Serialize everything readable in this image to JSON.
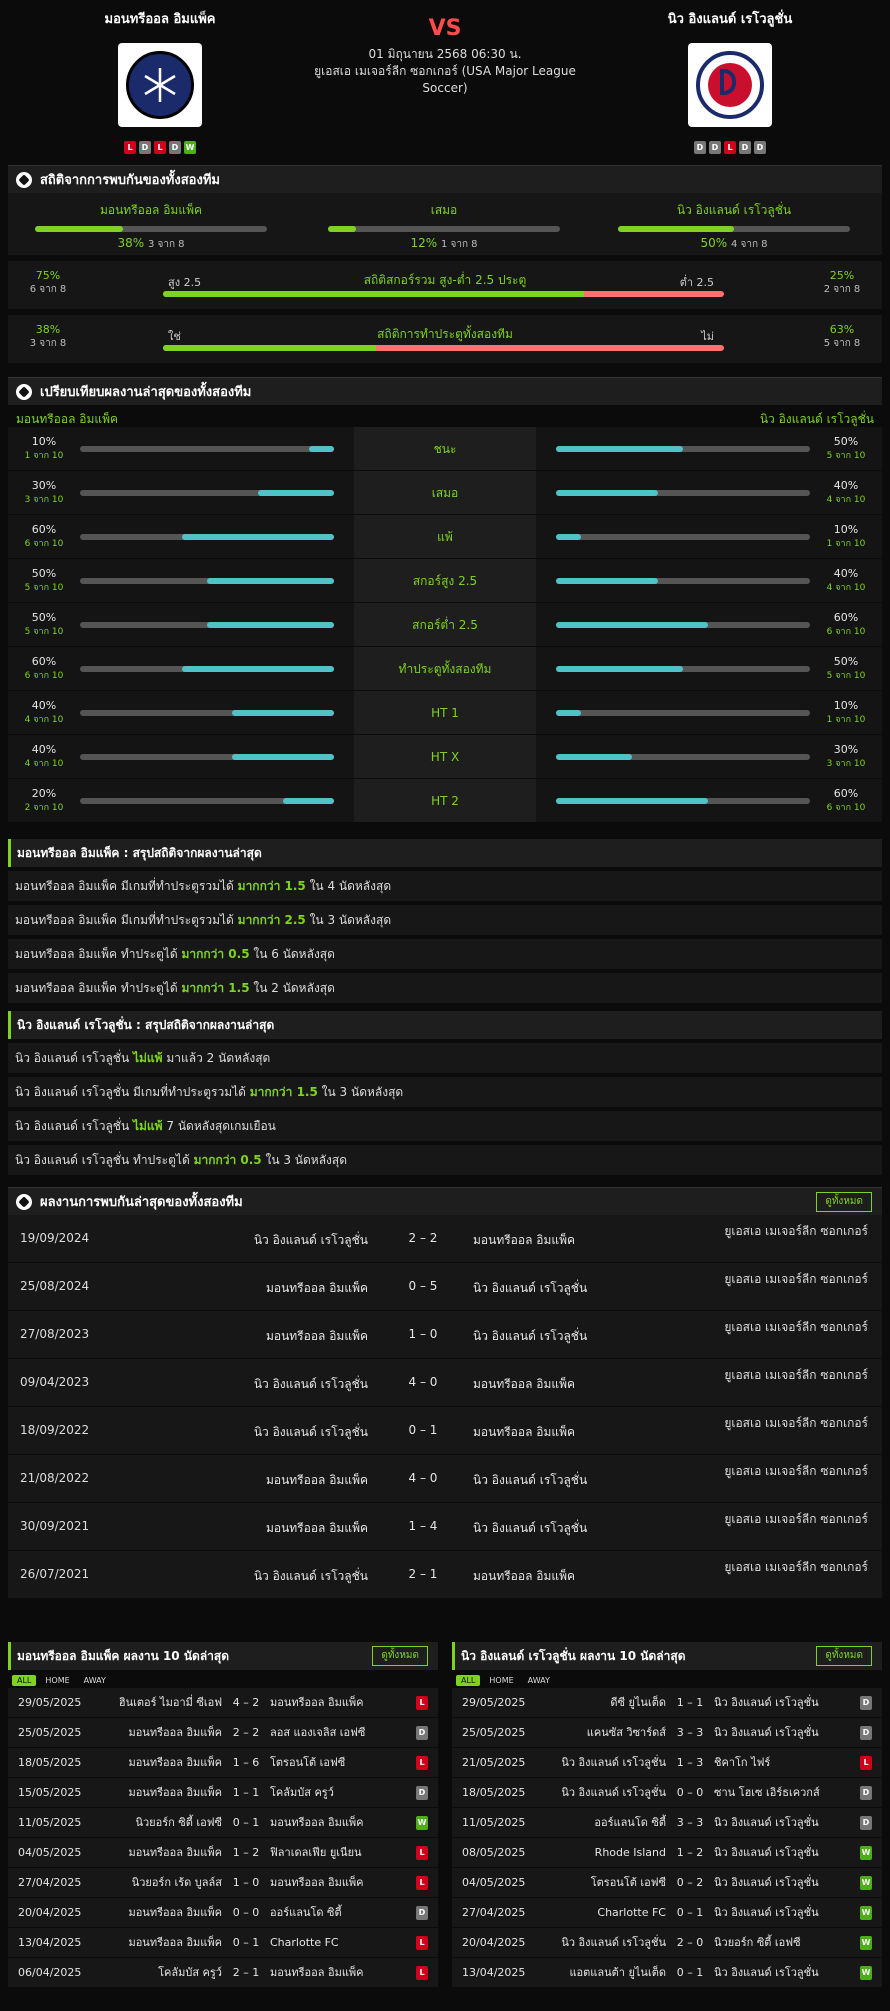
{
  "header": {
    "home_name": "มอนทรีออล อิมแพ็ค",
    "away_name": "นิว อิงแลนด์ เรโวลูชั่น",
    "vs": "VS",
    "datetime": "01 มิถุนายน 2568 06:30 น.",
    "league": "ยูเอสเอ เมเจอร์ลีก ซอกเกอร์ (USA Major League Soccer)",
    "home_form": [
      "L",
      "D",
      "L",
      "D",
      "W"
    ],
    "away_form": [
      "D",
      "D",
      "L",
      "D",
      "D"
    ],
    "home_logo_color": "#1b2a6b",
    "away_logo_color": "#c8102e"
  },
  "h2h_stats": {
    "title": "สถิติจากการพบกันของทั้งสองทีม",
    "cols": [
      {
        "label": "มอนทรีออล อิมแพ็ค",
        "pct": "38%",
        "count": "3 จาก 8",
        "value": 0.38
      },
      {
        "label": "เสมอ",
        "pct": "12%",
        "count": "1 จาก 8",
        "value": 0.12
      },
      {
        "label": "นิว อิงแลนด์ เรโวลูชั่น",
        "pct": "50%",
        "count": "4 จาก 8",
        "value": 0.5
      }
    ],
    "ou": {
      "left_pct": "75%",
      "left_count": "6 จาก 8",
      "left_label": "สูง 2.5",
      "title": "สถิติสกอร์รวม สูง-ต่ำ 2.5 ประตู",
      "right_label": "ต่ำ 2.5",
      "right_pct": "25%",
      "right_count": "2 จาก 8",
      "value": 0.75
    },
    "btts": {
      "left_pct": "38%",
      "left_count": "3 จาก 8",
      "left_label": "ใช่",
      "title": "สถิติการทำประตูทั้งสองทีม",
      "right_label": "ไม่",
      "right_pct": "63%",
      "right_count": "5 จาก 8",
      "value": 0.38
    }
  },
  "compare": {
    "title": "เปรียบเทียบผลงานล่าสุดของทั้งสองทีม",
    "home_name": "มอนทรีออล อิมแพ็ค",
    "away_name": "นิว อิงแลนด์ เรโวลูชั่น",
    "rows": [
      {
        "label": "ชนะ",
        "hp": "10%",
        "hc": "1 จาก 10",
        "hv": 0.1,
        "ap": "50%",
        "ac": "5 จาก 10",
        "av": 0.5
      },
      {
        "label": "เสมอ",
        "hp": "30%",
        "hc": "3 จาก 10",
        "hv": 0.3,
        "ap": "40%",
        "ac": "4 จาก 10",
        "av": 0.4
      },
      {
        "label": "แพ้",
        "hp": "60%",
        "hc": "6 จาก 10",
        "hv": 0.6,
        "ap": "10%",
        "ac": "1 จาก 10",
        "av": 0.1
      },
      {
        "label": "สกอร์สูง 2.5",
        "hp": "50%",
        "hc": "5 จาก 10",
        "hv": 0.5,
        "ap": "40%",
        "ac": "4 จาก 10",
        "av": 0.4
      },
      {
        "label": "สกอร์ต่ำ 2.5",
        "hp": "50%",
        "hc": "5 จาก 10",
        "hv": 0.5,
        "ap": "60%",
        "ac": "6 จาก 10",
        "av": 0.6
      },
      {
        "label": "ทำประตูทั้งสองทีม",
        "hp": "60%",
        "hc": "6 จาก 10",
        "hv": 0.6,
        "ap": "50%",
        "ac": "5 จาก 10",
        "av": 0.5
      },
      {
        "label": "HT 1",
        "hp": "40%",
        "hc": "4 จาก 10",
        "hv": 0.4,
        "ap": "10%",
        "ac": "1 จาก 10",
        "av": 0.1
      },
      {
        "label": "HT X",
        "hp": "40%",
        "hc": "4 จาก 10",
        "hv": 0.4,
        "ap": "30%",
        "ac": "3 จาก 10",
        "av": 0.3
      },
      {
        "label": "HT 2",
        "hp": "20%",
        "hc": "2 จาก 10",
        "hv": 0.2,
        "ap": "60%",
        "ac": "6 จาก 10",
        "av": 0.6
      }
    ]
  },
  "home_streaks": {
    "title": "มอนทรีออล อิมแพ็ค : สรุปสถิติจากผลงานล่าสุด",
    "rows": [
      [
        "มอนทรีออล อิมแพ็ค มีเกมที่ทำประตูรวมได้ ",
        "มากกว่า 1.5",
        " ใน 4 นัดหลังสุด"
      ],
      [
        "มอนทรีออล อิมแพ็ค มีเกมที่ทำประตูรวมได้ ",
        "มากกว่า 2.5",
        " ใน 3 นัดหลังสุด"
      ],
      [
        "มอนทรีออล อิมแพ็ค ทำประตูได้ ",
        "มากกว่า 0.5",
        " ใน 6 นัดหลังสุด"
      ],
      [
        "มอนทรีออล อิมแพ็ค ทำประตูได้ ",
        "มากกว่า 1.5",
        " ใน 2 นัดหลังสุด"
      ]
    ]
  },
  "away_streaks": {
    "title": "นิว อิงแลนด์ เรโวลูชั่น : สรุปสถิติจากผลงานล่าสุด",
    "rows": [
      [
        "นิว อิงแลนด์ เรโวลูชั่น ",
        "ไม่แพ้",
        " มาแล้ว 2 นัดหลังสุด"
      ],
      [
        "นิว อิงแลนด์ เรโวลูชั่น มีเกมที่ทำประตูรวมได้ ",
        "มากกว่า 1.5",
        " ใน 3 นัดหลังสุด"
      ],
      [
        "นิว อิงแลนด์ เรโวลูชั่น ",
        "ไม่แพ้",
        " 7 นัดหลังสุดเกมเยือน"
      ],
      [
        "นิว อิงแลนด์ เรโวลูชั่น ทำประตูได้ ",
        "มากกว่า 0.5",
        " ใน 3 นัดหลังสุด"
      ]
    ]
  },
  "h2h_results": {
    "title": "ผลงานการพบกันล่าสุดของทั้งสองทีม",
    "view_all": "ดูทั้งหมด",
    "rows": [
      {
        "date": "19/09/2024",
        "home": "นิว อิงแลนด์ เรโวลูชั่น",
        "score": "2 – 2",
        "away": "มอนทรีออล อิมแพ็ค",
        "league": "ยูเอสเอ เมเจอร์ลีก ซอกเกอร์"
      },
      {
        "date": "25/08/2024",
        "home": "มอนทรีออล อิมแพ็ค",
        "score": "0 – 5",
        "away": "นิว อิงแลนด์ เรโวลูชั่น",
        "league": "ยูเอสเอ เมเจอร์ลีก ซอกเกอร์"
      },
      {
        "date": "27/08/2023",
        "home": "มอนทรีออล อิมแพ็ค",
        "score": "1 – 0",
        "away": "นิว อิงแลนด์ เรโวลูชั่น",
        "league": "ยูเอสเอ เมเจอร์ลีก ซอกเกอร์"
      },
      {
        "date": "09/04/2023",
        "home": "นิว อิงแลนด์ เรโวลูชั่น",
        "score": "4 – 0",
        "away": "มอนทรีออล อิมแพ็ค",
        "league": "ยูเอสเอ เมเจอร์ลีก ซอกเกอร์"
      },
      {
        "date": "18/09/2022",
        "home": "นิว อิงแลนด์ เรโวลูชั่น",
        "score": "0 – 1",
        "away": "มอนทรีออล อิมแพ็ค",
        "league": "ยูเอสเอ เมเจอร์ลีก ซอกเกอร์"
      },
      {
        "date": "21/08/2022",
        "home": "มอนทรีออล อิมแพ็ค",
        "score": "4 – 0",
        "away": "นิว อิงแลนด์ เรโวลูชั่น",
        "league": "ยูเอสเอ เมเจอร์ลีก ซอกเกอร์"
      },
      {
        "date": "30/09/2021",
        "home": "มอนทรีออล อิมแพ็ค",
        "score": "1 – 4",
        "away": "นิว อิงแลนด์ เรโวลูชั่น",
        "league": "ยูเอสเอ เมเจอร์ลีก ซอกเกอร์"
      },
      {
        "date": "26/07/2021",
        "home": "นิว อิงแลนด์ เรโวลูชั่น",
        "score": "2 – 1",
        "away": "มอนทรีออล อิมแพ็ค",
        "league": "ยูเอสเอ เมเจอร์ลีก ซอกเกอร์"
      }
    ]
  },
  "home_last10": {
    "title": "มอนทรีออล อิมแพ็ค ผลงาน 10 นัดล่าสุด",
    "view_all": "ดูทั้งหมด",
    "filters": [
      "ALL",
      "HOME",
      "AWAY"
    ],
    "rows": [
      {
        "date": "29/05/2025",
        "home": "ฮินเตอร์ ไมอามี่ ซีเอฟ",
        "score": "4 – 2",
        "away": "มอนทรีออล อิมแพ็ค",
        "res": "L"
      },
      {
        "date": "25/05/2025",
        "home": "มอนทรีออล อิมแพ็ค",
        "score": "2 – 2",
        "away": "ลอส แองเจลิส เอฟซี",
        "res": "D"
      },
      {
        "date": "18/05/2025",
        "home": "มอนทรีออล อิมแพ็ค",
        "score": "1 – 6",
        "away": "โตรอนโต้ เอฟซี",
        "res": "L"
      },
      {
        "date": "15/05/2025",
        "home": "มอนทรีออล อิมแพ็ค",
        "score": "1 – 1",
        "away": "โคลัมบัส ครูว์",
        "res": "D"
      },
      {
        "date": "11/05/2025",
        "home": "นิวยอร์ก ซิตี้ เอฟซี",
        "score": "0 – 1",
        "away": "มอนทรีออล อิมแพ็ค",
        "res": "W"
      },
      {
        "date": "04/05/2025",
        "home": "มอนทรีออล อิมแพ็ค",
        "score": "1 – 2",
        "away": "ฟิลาเดลเฟีย ยูเนียน",
        "res": "L"
      },
      {
        "date": "27/04/2025",
        "home": "นิวยอร์ก เร้ด บูลล์ส",
        "score": "1 – 0",
        "away": "มอนทรีออล อิมแพ็ค",
        "res": "L"
      },
      {
        "date": "20/04/2025",
        "home": "มอนทรีออล อิมแพ็ค",
        "score": "0 – 0",
        "away": "ออร์แลนโด ซิตี้",
        "res": "D"
      },
      {
        "date": "13/04/2025",
        "home": "มอนทรีออล อิมแพ็ค",
        "score": "0 – 1",
        "away": "Charlotte FC",
        "res": "L"
      },
      {
        "date": "06/04/2025",
        "home": "โคลัมบัส ครูว์",
        "score": "2 – 1",
        "away": "มอนทรีออล อิมแพ็ค",
        "res": "L"
      }
    ]
  },
  "away_last10": {
    "title": "นิว อิงแลนด์ เรโวลูชั่น ผลงาน 10 นัดล่าสุด",
    "view_all": "ดูทั้งหมด",
    "filters": [
      "ALL",
      "HOME",
      "AWAY"
    ],
    "rows": [
      {
        "date": "29/05/2025",
        "home": "ดีซี ยูไนเต็ด",
        "score": "1 – 1",
        "away": "นิว อิงแลนด์ เรโวลูชั่น",
        "res": "D"
      },
      {
        "date": "25/05/2025",
        "home": "แคนซัส วิซาร์ดส์",
        "score": "3 – 3",
        "away": "นิว อิงแลนด์ เรโวลูชั่น",
        "res": "D"
      },
      {
        "date": "21/05/2025",
        "home": "นิว อิงแลนด์ เรโวลูชั่น",
        "score": "1 – 3",
        "away": "ชิคาโก ไฟร์",
        "res": "L"
      },
      {
        "date": "18/05/2025",
        "home": "นิว อิงแลนด์ เรโวลูชั่น",
        "score": "0 – 0",
        "away": "ซาน โฮเซ เอิร์ธเควกส์",
        "res": "D"
      },
      {
        "date": "11/05/2025",
        "home": "ออร์แลนโด ซิตี้",
        "score": "3 – 3",
        "away": "นิว อิงแลนด์ เรโวลูชั่น",
        "res": "D"
      },
      {
        "date": "08/05/2025",
        "home": "Rhode Island",
        "score": "1 – 2",
        "away": "นิว อิงแลนด์ เรโวลูชั่น",
        "res": "W"
      },
      {
        "date": "04/05/2025",
        "home": "โตรอนโต้ เอฟซี",
        "score": "0 – 2",
        "away": "นิว อิงแลนด์ เรโวลูชั่น",
        "res": "W"
      },
      {
        "date": "27/04/2025",
        "home": "Charlotte FC",
        "score": "0 – 1",
        "away": "นิว อิงแลนด์ เรโวลูชั่น",
        "res": "W"
      },
      {
        "date": "20/04/2025",
        "home": "นิว อิงแลนด์ เรโวลูชั่น",
        "score": "2 – 0",
        "away": "นิวยอร์ก ซิตี้ เอฟซี",
        "res": "W"
      },
      {
        "date": "13/04/2025",
        "home": "แอตแลนต้า ยูไนเต็ด",
        "score": "0 – 1",
        "away": "นิว อิงแลนด์ เรโวลูชั่น",
        "res": "W"
      }
    ]
  }
}
